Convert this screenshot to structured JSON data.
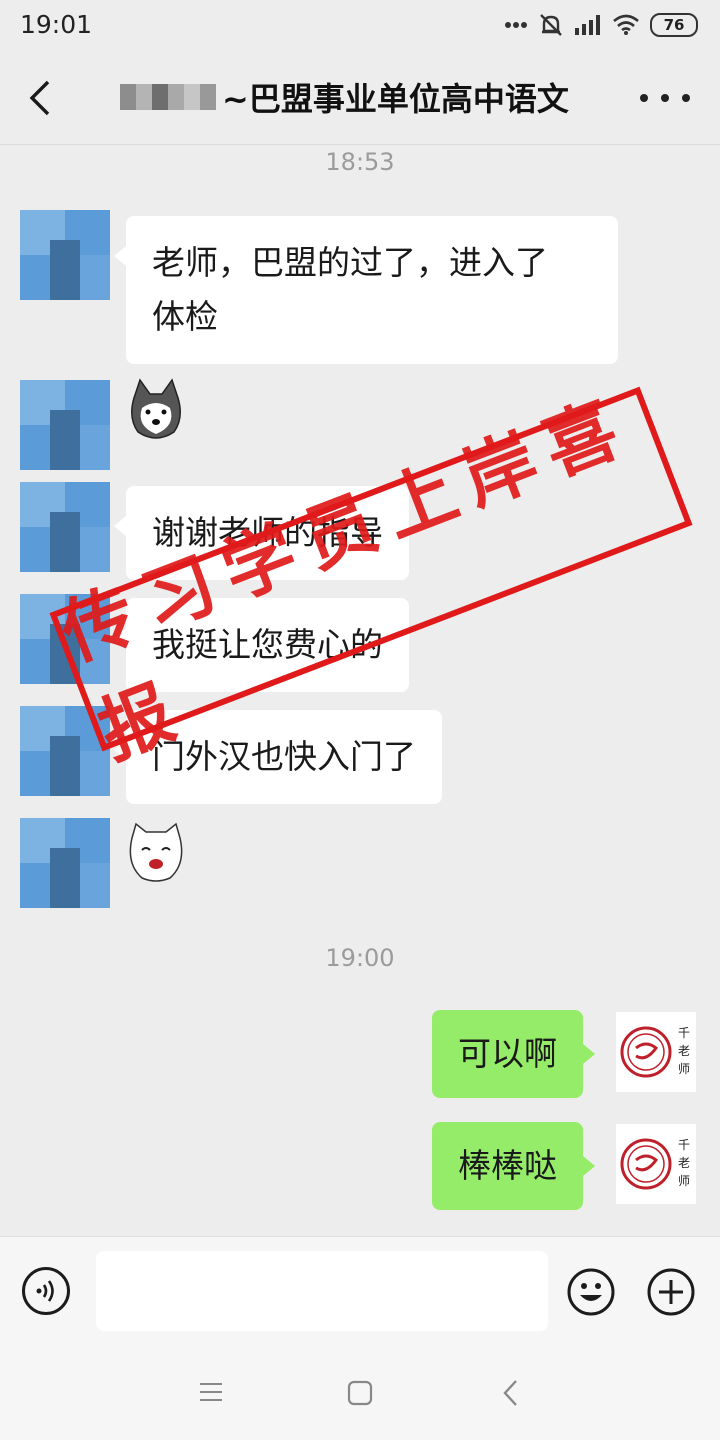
{
  "status_bar": {
    "time": "19:01",
    "battery": "76"
  },
  "header": {
    "title": "~巴盟事业单位高中语文"
  },
  "messages": {
    "time1": "18:53",
    "m1_line1": "老师，巴盟的过了，进入了",
    "m1_line2": "体检",
    "m2": "谢谢老师的指导",
    "m3": "我挺让您费心的",
    "m4": "门外汉也快入门了",
    "time2": "19:00",
    "r1": "可以啊",
    "r2": "棒棒哒"
  },
  "stamp_text": "传习学员上岸喜报",
  "teacher_avatar_text": "千老师",
  "colors": {
    "stamp": "#e01a1a",
    "bubble_right": "#95ec69",
    "background": "#ededed"
  }
}
